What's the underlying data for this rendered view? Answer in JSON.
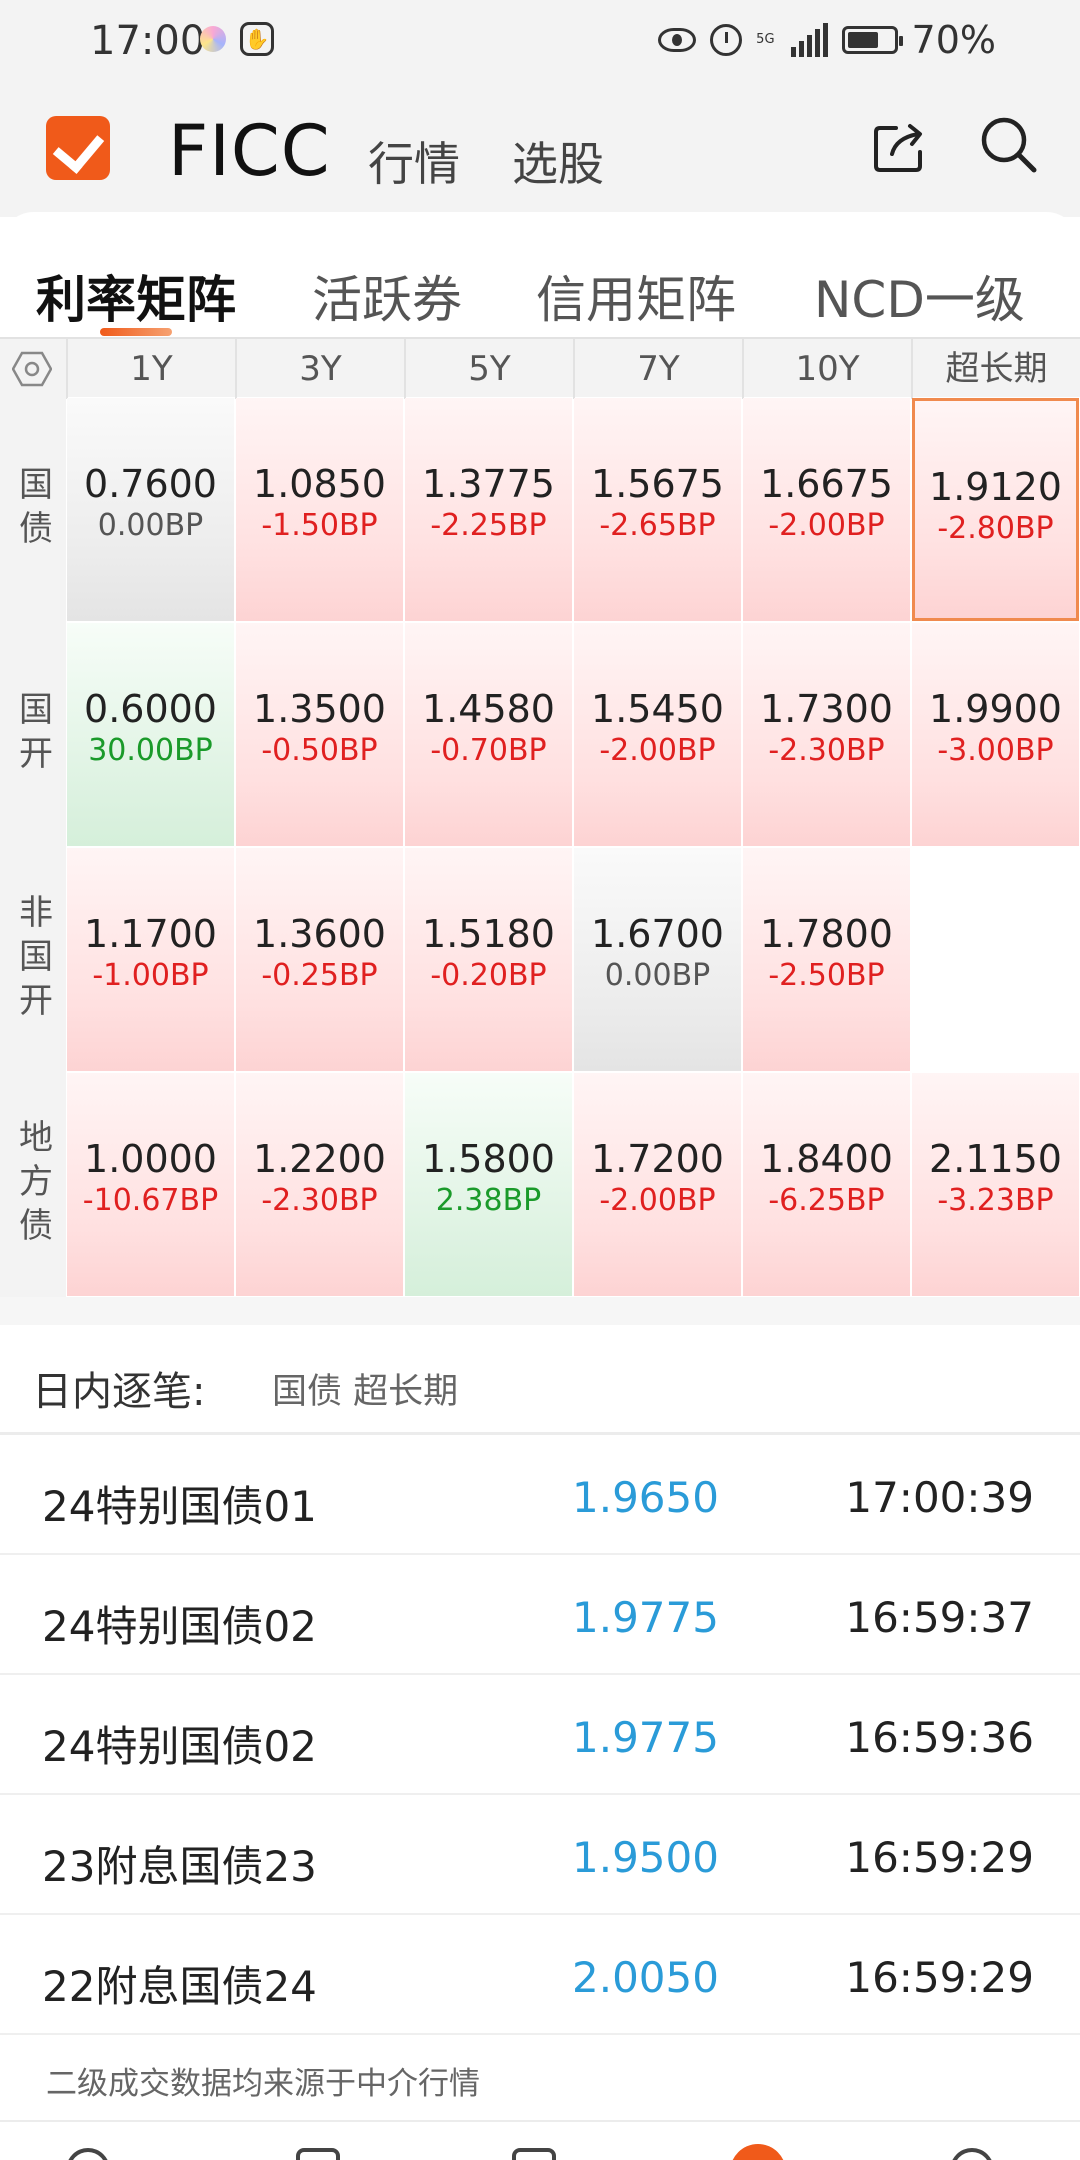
{
  "status_bar": {
    "time": "17:00",
    "battery": "70%",
    "signal_label": "5G",
    "battery_level": 0.7
  },
  "header": {
    "title": "FICC",
    "nav": [
      "行情",
      "选股"
    ]
  },
  "tabs": [
    {
      "label": "利率矩阵",
      "active": true
    },
    {
      "label": "活跃券",
      "active": false
    },
    {
      "label": "信用矩阵",
      "active": false
    },
    {
      "label": "NCD一级",
      "active": false
    }
  ],
  "matrix": {
    "columns": [
      "1Y",
      "3Y",
      "5Y",
      "7Y",
      "10Y",
      "超长期"
    ],
    "rows": [
      {
        "label": "国债",
        "cells": [
          {
            "value": "0.7600",
            "change": "0.00BP",
            "tone": "gray"
          },
          {
            "value": "1.0850",
            "change": "-1.50BP",
            "tone": "red"
          },
          {
            "value": "1.3775",
            "change": "-2.25BP",
            "tone": "red"
          },
          {
            "value": "1.5675",
            "change": "-2.65BP",
            "tone": "red"
          },
          {
            "value": "1.6675",
            "change": "-2.00BP",
            "tone": "red"
          },
          {
            "value": "1.9120",
            "change": "-2.80BP",
            "tone": "red",
            "selected": true
          }
        ]
      },
      {
        "label": "国开",
        "cells": [
          {
            "value": "0.6000",
            "change": "30.00BP",
            "tone": "green"
          },
          {
            "value": "1.3500",
            "change": "-0.50BP",
            "tone": "red"
          },
          {
            "value": "1.4580",
            "change": "-0.70BP",
            "tone": "red"
          },
          {
            "value": "1.5450",
            "change": "-2.00BP",
            "tone": "red"
          },
          {
            "value": "1.7300",
            "change": "-2.30BP",
            "tone": "red"
          },
          {
            "value": "1.9900",
            "change": "-3.00BP",
            "tone": "red"
          }
        ]
      },
      {
        "label": "非国开",
        "cells": [
          {
            "value": "1.1700",
            "change": "-1.00BP",
            "tone": "red"
          },
          {
            "value": "1.3600",
            "change": "-0.25BP",
            "tone": "red"
          },
          {
            "value": "1.5180",
            "change": "-0.20BP",
            "tone": "red"
          },
          {
            "value": "1.6700",
            "change": "0.00BP",
            "tone": "gray"
          },
          {
            "value": "1.7800",
            "change": "-2.50BP",
            "tone": "red"
          },
          {
            "value": "",
            "change": "",
            "tone": "empty"
          }
        ]
      },
      {
        "label": "地方债",
        "cells": [
          {
            "value": "1.0000",
            "change": "-10.67BP",
            "tone": "red"
          },
          {
            "value": "1.2200",
            "change": "-2.30BP",
            "tone": "red"
          },
          {
            "value": "1.5800",
            "change": "2.38BP",
            "tone": "green"
          },
          {
            "value": "1.7200",
            "change": "-2.00BP",
            "tone": "red"
          },
          {
            "value": "1.8400",
            "change": "-6.25BP",
            "tone": "red"
          },
          {
            "value": "2.1150",
            "change": "-3.23BP",
            "tone": "red"
          }
        ]
      }
    ]
  },
  "intraday": {
    "title": "日内逐笔:",
    "filter": "国债 超长期",
    "trades": [
      {
        "name": "24特别国债01",
        "yield": "1.9650",
        "time": "17:00:39"
      },
      {
        "name": "24特别国债02",
        "yield": "1.9775",
        "time": "16:59:37"
      },
      {
        "name": "24特别国债02",
        "yield": "1.9775",
        "time": "16:59:36"
      },
      {
        "name": "23附息国债23",
        "yield": "1.9500",
        "time": "16:59:29"
      },
      {
        "name": "22附息国债24",
        "yield": "2.0050",
        "time": "16:59:29"
      }
    ]
  },
  "footnote": "二级成交数据均来源于中介行情",
  "icons": {
    "logo": "checkbox-logo-icon",
    "share": "share-icon",
    "search": "search-icon",
    "settings": "hexagon-settings-icon"
  },
  "colors": {
    "accent": "#f05a1a",
    "down": "#e02020",
    "up": "#1a9a2a",
    "yield": "#2a9bd8"
  }
}
